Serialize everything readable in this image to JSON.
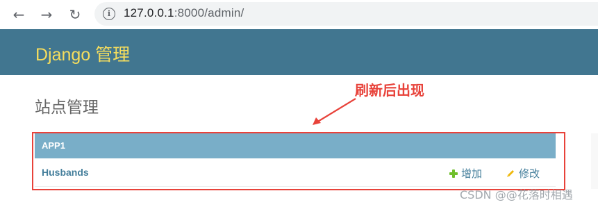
{
  "browser": {
    "url_host": "127.0.0.1",
    "url_rest": ":8000/admin/",
    "back_icon": "←",
    "forward_icon": "→",
    "reload_icon": "↻"
  },
  "header": {
    "branding": "Django 管理"
  },
  "main": {
    "title": "站点管理",
    "apps": [
      {
        "caption": "APP1",
        "models": [
          {
            "name": "Husbands",
            "add_label": "增加",
            "change_label": "修改"
          }
        ]
      }
    ]
  },
  "annotation": {
    "text": "刷新后出现"
  },
  "watermark": {
    "text": "CSDN @@花落时相遇"
  },
  "colors": {
    "header_bg": "#417690",
    "branding": "#f5dd5d",
    "caption_bg": "#79aec8",
    "link": "#447e9b",
    "add_icon": "#70bf2b",
    "change_icon": "#efb80b",
    "annotation": "#e8423a"
  }
}
